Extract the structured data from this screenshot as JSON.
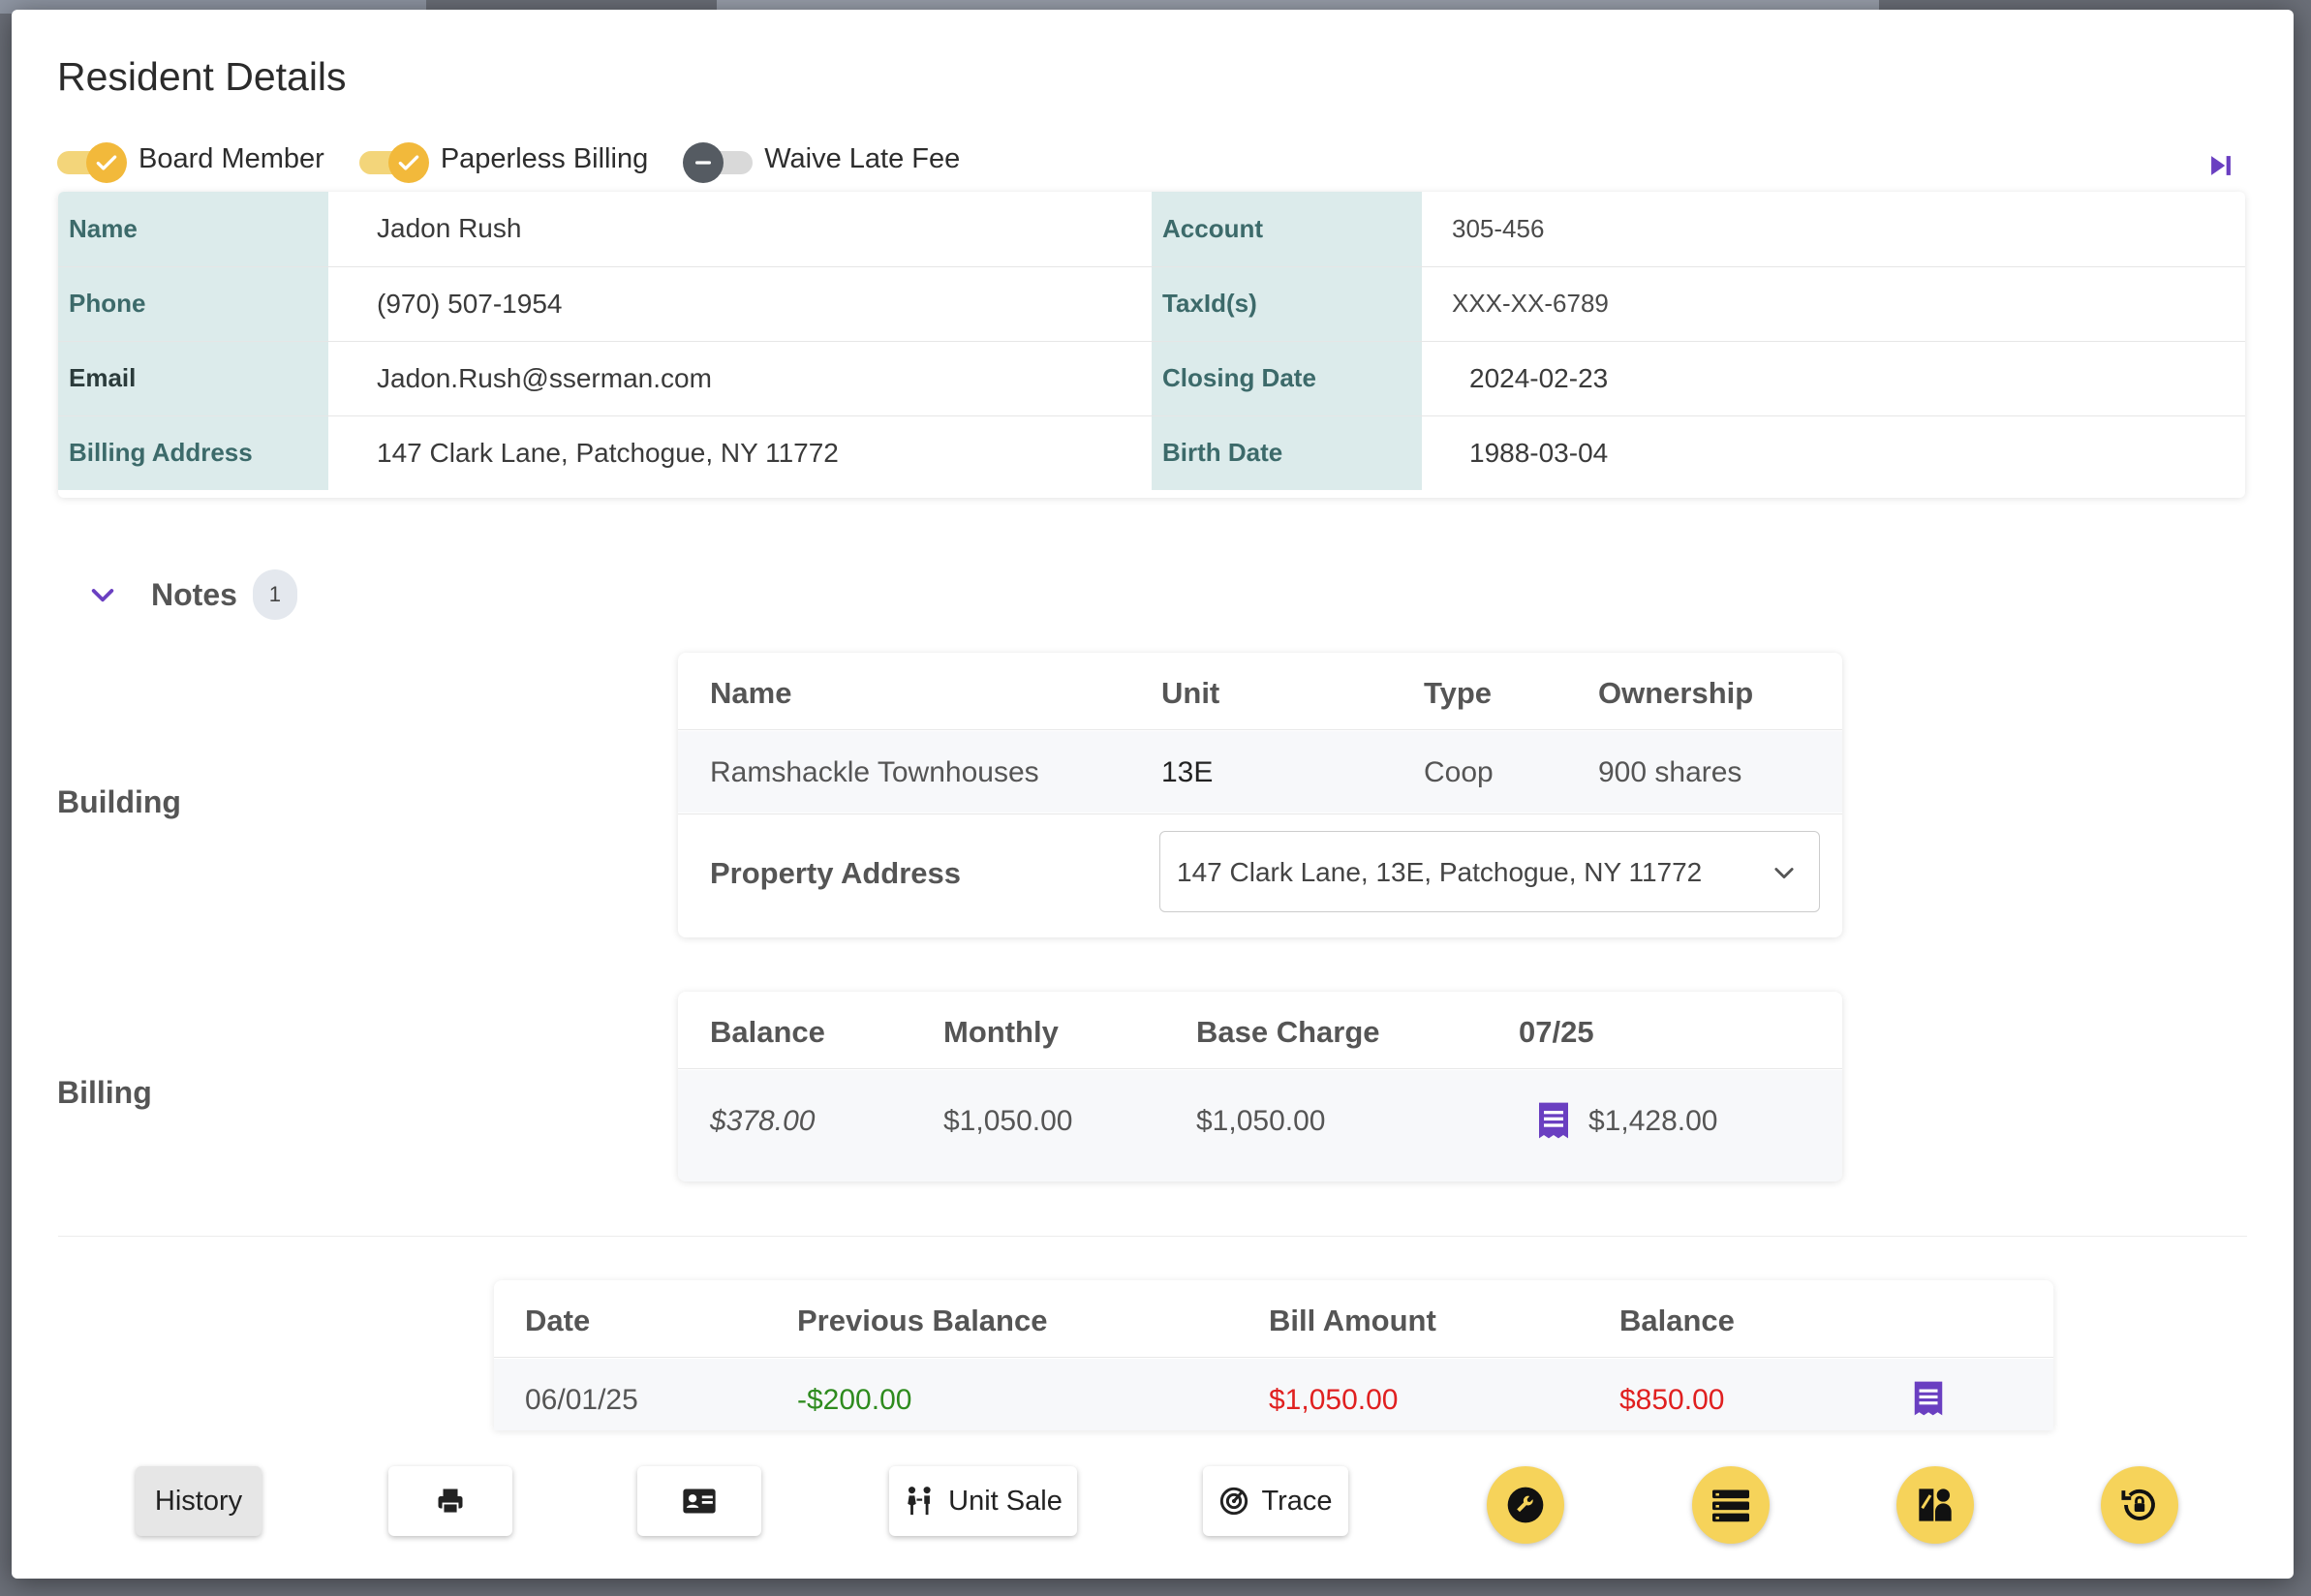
{
  "modal": {
    "title": "Resident Details"
  },
  "toggles": [
    {
      "label": "Board Member",
      "on": true
    },
    {
      "label": "Paperless Billing",
      "on": true
    },
    {
      "label": "Waive Late Fee",
      "on": false
    }
  ],
  "resident": {
    "name_label": "Name",
    "name": "Jadon Rush",
    "phone_label": "Phone",
    "phone": "(970) 507-1954",
    "email_label": "Email",
    "email": "Jadon.Rush@sserman.com",
    "address_label": "Billing Address",
    "address": "147 Clark Lane, Patchogue, NY 11772",
    "account_label": "Account",
    "account": "305-456",
    "taxid_label": "TaxId(s)",
    "taxid": "XXX-XX-6789",
    "closing_label": "Closing Date",
    "closing": "2024-02-23",
    "birth_label": "Birth Date",
    "birth": "1988-03-04"
  },
  "notes": {
    "label": "Notes",
    "count": "1"
  },
  "building": {
    "section_label": "Building",
    "headers": {
      "name": "Name",
      "unit": "Unit",
      "type": "Type",
      "ownership": "Ownership"
    },
    "row": {
      "name": "Ramshackle Townhouses",
      "unit": "13E",
      "type": "Coop",
      "ownership": "900 shares"
    },
    "property_label": "Property Address",
    "property_value": "147 Clark Lane, 13E, Patchogue, NY 11772"
  },
  "billing": {
    "section_label": "Billing",
    "headers": {
      "balance": "Balance",
      "monthly": "Monthly",
      "base": "Base Charge",
      "period": "07/25"
    },
    "row": {
      "balance": "$378.00",
      "monthly": "$1,050.00",
      "base": "$1,050.00",
      "period_amount": "$1,428.00"
    }
  },
  "history": {
    "headers": {
      "date": "Date",
      "prev": "Previous Balance",
      "bill": "Bill Amount",
      "balance": "Balance"
    },
    "rows": [
      {
        "date": "06/01/25",
        "prev": "-$200.00",
        "bill": "$1,050.00",
        "balance": "$850.00"
      }
    ]
  },
  "toolbar": {
    "history": "History",
    "unit_sale": "Unit Sale",
    "trace": "Trace"
  },
  "colors": {
    "accent": "#f2b93b",
    "purple": "#6a3fc1",
    "label_bg": "#dcebeb",
    "positive": "#2e8b1e",
    "negative": "#e02020"
  }
}
